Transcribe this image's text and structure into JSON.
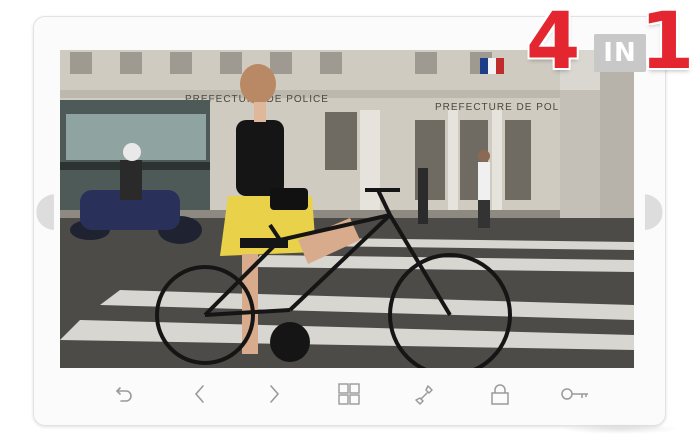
{
  "badge": {
    "number_left": "4",
    "in_text": "IN",
    "number_right": "1",
    "number_color": "#e3262f"
  },
  "photo": {
    "sign_left": "PREFECTURE DE POLICE",
    "sign_right": "PREFECTURE DE POLICE"
  },
  "toolbar": {
    "buttons": [
      {
        "icon": "back-icon"
      },
      {
        "icon": "chevron-left-icon"
      },
      {
        "icon": "chevron-right-icon"
      },
      {
        "icon": "grid-icon"
      },
      {
        "icon": "phone-handset-icon"
      },
      {
        "icon": "lock-icon"
      },
      {
        "icon": "key-icon"
      }
    ],
    "icon_color": "#9a9a9a"
  }
}
